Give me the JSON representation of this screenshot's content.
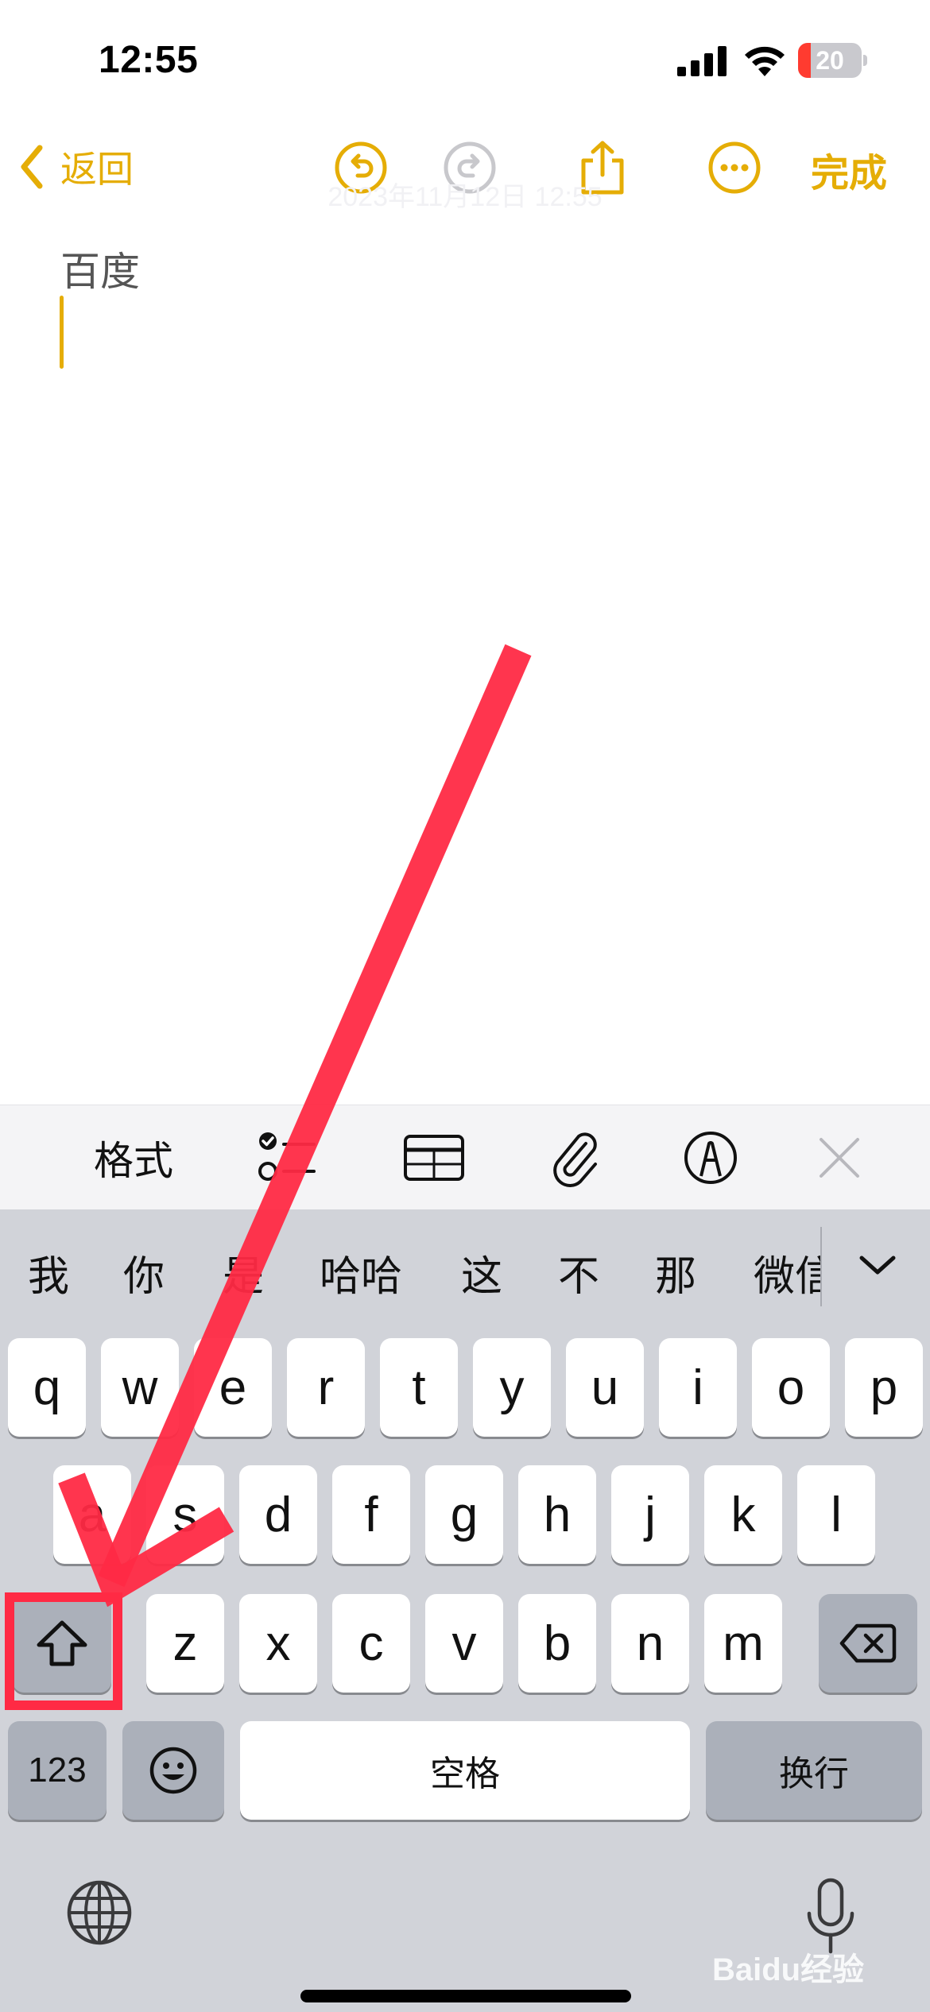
{
  "status_bar": {
    "time": "12:55",
    "battery_level": "20",
    "battery_fraction": 0.2,
    "icons": [
      "cellular-signal-icon",
      "wifi-icon",
      "battery-icon"
    ]
  },
  "nav": {
    "back_label": "返回",
    "done_label": "完成",
    "faded_date": "2023年11月12日 12:55",
    "icons": [
      "undo-icon",
      "redo-icon",
      "share-icon",
      "more-icon"
    ]
  },
  "note": {
    "title": "百度"
  },
  "toolbar": {
    "format_label": "格式",
    "icons": [
      "checklist-icon",
      "table-icon",
      "attachment-icon",
      "markup-icon",
      "close-icon"
    ]
  },
  "keyboard": {
    "candidates": [
      "我",
      "你",
      "是",
      "哈哈",
      "这",
      "不",
      "那",
      "微信"
    ],
    "row1": [
      "q",
      "w",
      "e",
      "r",
      "t",
      "y",
      "u",
      "i",
      "o",
      "p"
    ],
    "row2": [
      "a",
      "s",
      "d",
      "f",
      "g",
      "h",
      "j",
      "k",
      "l"
    ],
    "row3": [
      "z",
      "x",
      "c",
      "v",
      "b",
      "n",
      "m"
    ],
    "numbers_label": "123",
    "space_label": "空格",
    "return_label": "换行",
    "watermark": "Baidu经验"
  },
  "colors": {
    "accent": "#e5ad06",
    "annotation": "#ff2a44",
    "keyboard_bg": "#d1d3d9",
    "special_key": "#abb0ba"
  }
}
